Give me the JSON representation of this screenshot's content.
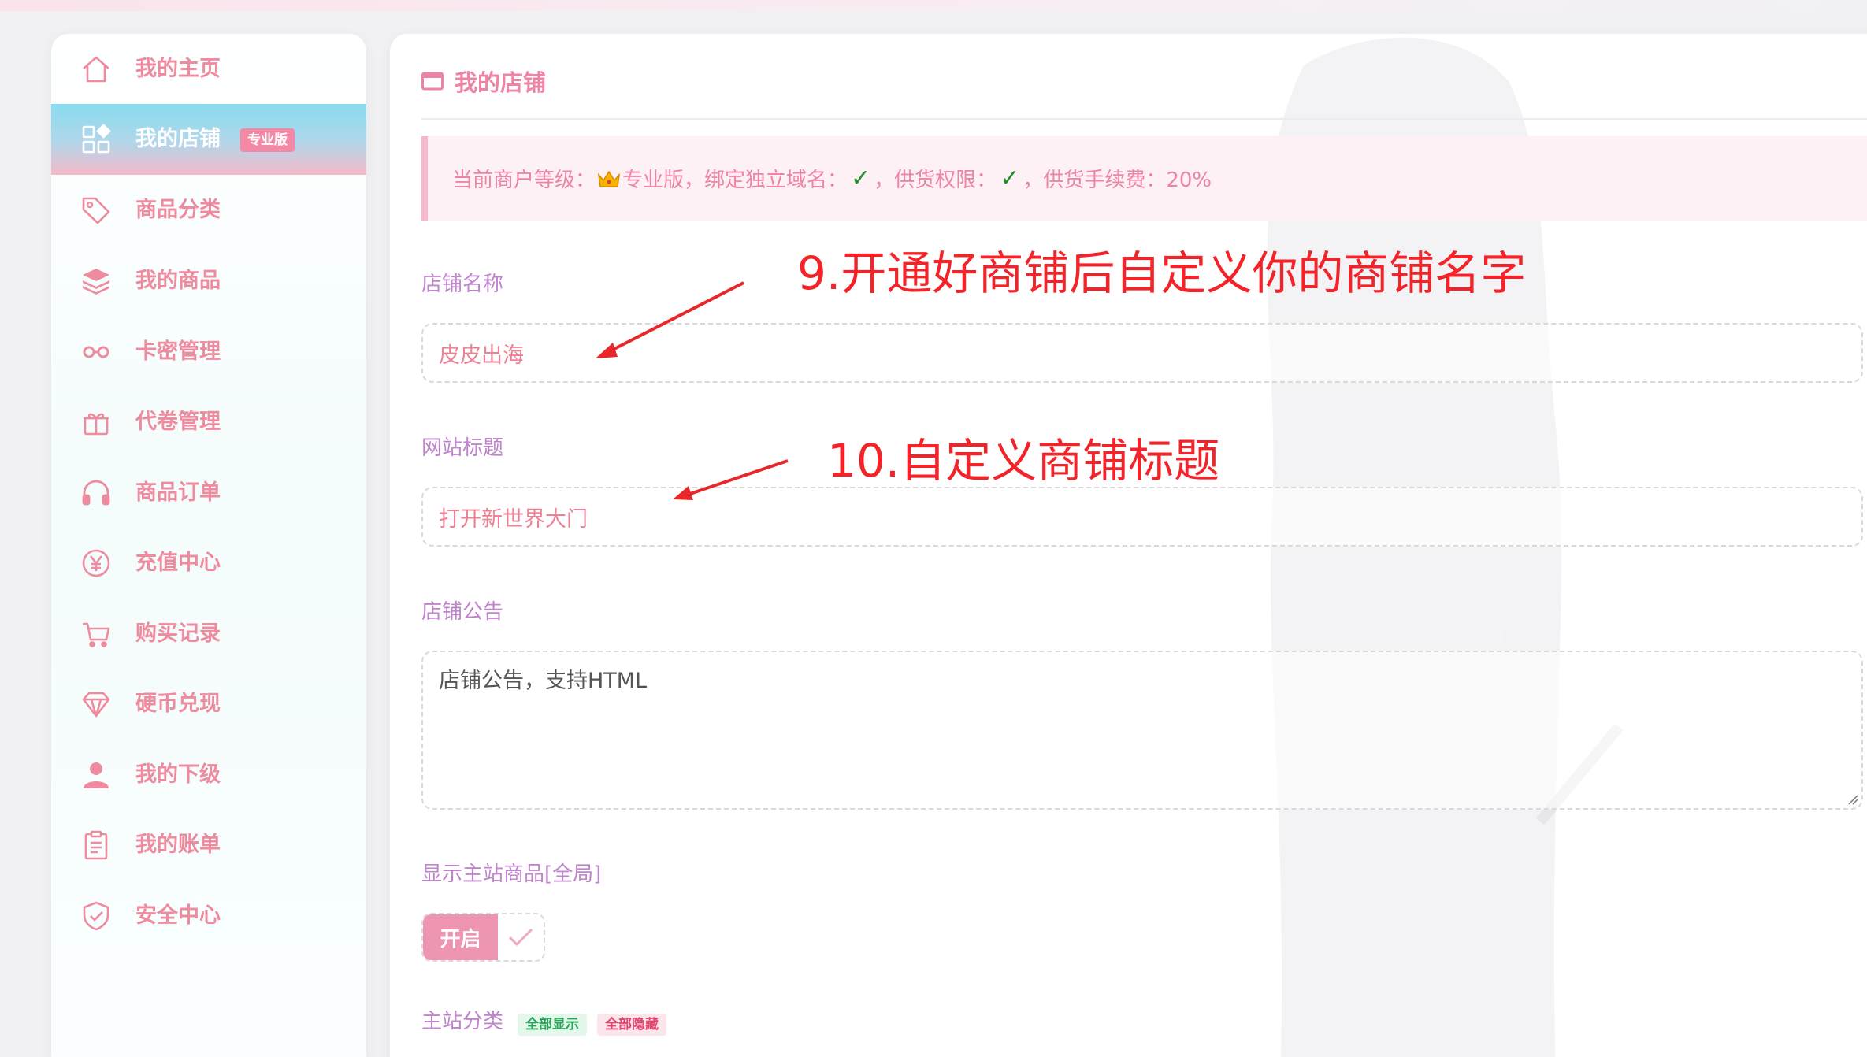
{
  "sidebar": {
    "items": [
      {
        "label": "我的主页",
        "icon": "home-icon"
      },
      {
        "label": "我的店铺",
        "icon": "store-apps-icon",
        "badge": "专业版",
        "active": true
      },
      {
        "label": "商品分类",
        "icon": "tag-icon"
      },
      {
        "label": "我的商品",
        "icon": "layers-icon"
      },
      {
        "label": "卡密管理",
        "icon": "infinity-key-icon"
      },
      {
        "label": "代卷管理",
        "icon": "gift-icon"
      },
      {
        "label": "商品订单",
        "icon": "headset-icon"
      },
      {
        "label": "充值中心",
        "icon": "yen-circle-icon"
      },
      {
        "label": "购买记录",
        "icon": "cart-icon"
      },
      {
        "label": "硬币兑现",
        "icon": "diamond-icon"
      },
      {
        "label": "我的下级",
        "icon": "user-icon"
      },
      {
        "label": "我的账单",
        "icon": "clipboard-icon"
      },
      {
        "label": "安全中心",
        "icon": "shield-check-icon"
      }
    ]
  },
  "main": {
    "title": "我的店铺",
    "alert": {
      "level_prefix": "当前商户等级：",
      "level_value": "专业版，绑定独立域名：",
      "domain_check": "✓",
      "supply_label": "，供货权限：",
      "supply_check": "✓",
      "fee_text": "，供货手续费：20%"
    },
    "fields": {
      "shop_name": {
        "label": "店铺名称",
        "value": "皮皮出海"
      },
      "site_title": {
        "label": "网站标题",
        "value": "打开新世界大门"
      },
      "notice": {
        "label": "店铺公告",
        "placeholder": "店铺公告，支持HTML"
      },
      "show_main": {
        "label": "显示主站商品[全局]",
        "toggle_text": "开启",
        "enabled": true
      },
      "main_category": {
        "label": "主站分类",
        "tag_show_all": "全部显示",
        "tag_hide_all": "全部隐藏"
      }
    }
  },
  "annotations": {
    "step9": "9.开通好商铺后自定义你的商铺名字",
    "step10": "10.自定义商铺标题"
  },
  "colors": {
    "accent_pink": "#ee84a3",
    "annotation_red": "#f2242a",
    "check_green": "#1f8f2a",
    "label_purple": "#bf84cd"
  }
}
